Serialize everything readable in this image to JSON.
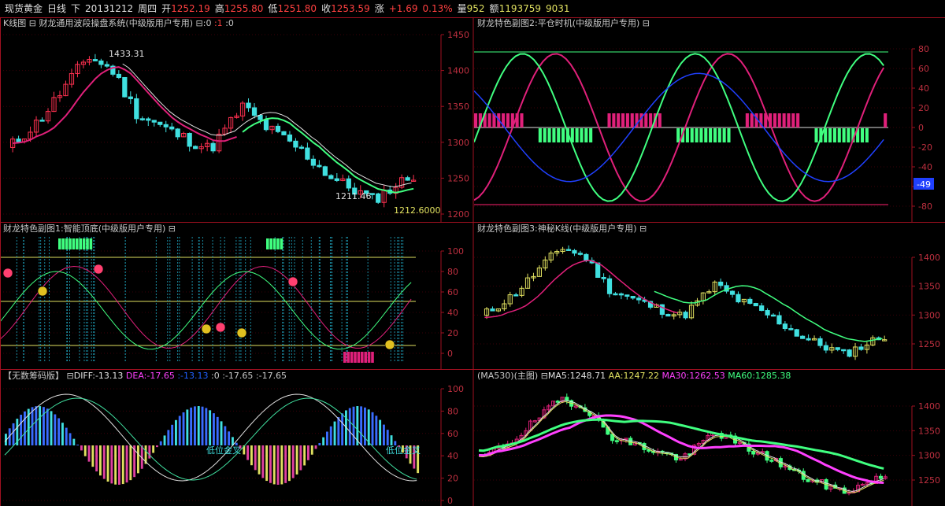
{
  "topbar": {
    "instrument": "现货黄金",
    "period": "日线",
    "direction": "下",
    "date": "20131212",
    "weekday": "周四",
    "open_label": "开",
    "open": "1252.19",
    "high_label": "高",
    "high": "1255.80",
    "low_label": "低",
    "low": "1251.80",
    "close_label": "收",
    "close": "1253.59",
    "change_label": "涨",
    "change": "+1.69",
    "change_pct": "0.13%",
    "volume_label": "量",
    "volume": "952",
    "amount_label": "额",
    "amount": "1193759",
    "extra": "9031"
  },
  "panel_kline": {
    "title": "K线图",
    "indicator": "财龙通用波段操盘系统(中级版用户专用)",
    "params": ":0",
    "param_red": ":1",
    "param_tail": ":0",
    "y_ticks": [
      "1450",
      "1400",
      "1350",
      "1300",
      "1250",
      "1200"
    ],
    "annotations": [
      "1433.31",
      "1211.46",
      "1212.6000"
    ]
  },
  "panel_sub2": {
    "title": "财龙特色副图2:平仓时机(中级版用户专用)",
    "y_ticks": [
      "80",
      "60",
      "40",
      "20",
      "0",
      "-20",
      "-40",
      "-60",
      "-80"
    ],
    "current_value": "-49"
  },
  "panel_sub1": {
    "title": "财龙特色副图1:智能顶底(中级版用户专用)",
    "y_ticks": [
      "100",
      "80",
      "60",
      "40",
      "20",
      "0"
    ]
  },
  "panel_sub3": {
    "title": "财龙特色副图3:神秘K线(中级版用户专用)",
    "y_ticks": [
      "1400",
      "1350",
      "1300",
      "1250"
    ]
  },
  "panel_chip": {
    "title": "【无数筹码版】",
    "diff": "DIFF:-13.13",
    "dea": "DEA:-17.65",
    "v3": ":-13.13",
    "v4": ":0",
    "v5": ":-17.65",
    "v6": ":-17.65",
    "y_ticks": [
      "100",
      "80",
      "60",
      "40",
      "20",
      "0"
    ],
    "cross_labels": [
      "低位金叉",
      "低位金叉"
    ]
  },
  "panel_ma": {
    "title": "(MA530)(主图)",
    "ma5": "MA5:1248.71",
    "aa": "AA:1247.22",
    "ma30": "MA30:1262.53",
    "ma60": "MA60:1285.38",
    "y_ticks": [
      "1400",
      "1350",
      "1300",
      "1250"
    ]
  },
  "colors": {
    "up": "#ff3050",
    "down": "#40e0e0",
    "grid": "#7a0a16",
    "yellow": "#e0e060",
    "green": "#40ff80",
    "magenta": "#ff40ff",
    "blue": "#2040ff"
  },
  "icons": [
    "sub-menu-icon"
  ]
}
